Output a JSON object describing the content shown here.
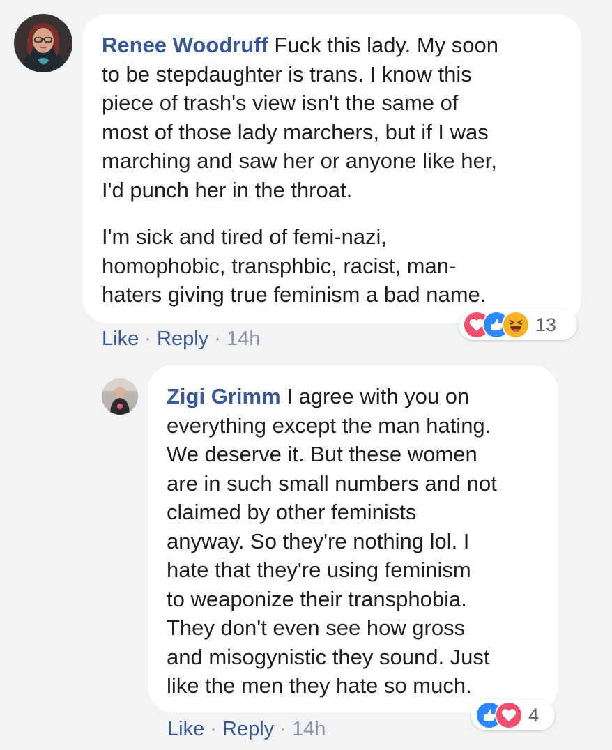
{
  "colors": {
    "background": "#f2f3f5",
    "bubble": "#ffffff",
    "author": "#385898",
    "meta": "#90949c",
    "love": "#f0506e",
    "like": "#2d88ff",
    "haha": "#f7b125"
  },
  "comments": [
    {
      "author": "Renee Woodruff",
      "paragraphs": [
        " Fuck this lady. My soon\nto be stepdaughter is trans. I know this\npiece of trash's view isn't the same of\nmost of those lady marchers, but if I was\nmarching and saw her or anyone like her,\nI'd punch her in the throat.",
        "I'm sick and tired of femi-nazi,\nhomophobic, transphbic, racist, man-\nhaters giving true feminism a bad name."
      ],
      "like_label": "Like",
      "reply_label": "Reply",
      "separator": "·",
      "time": "14h",
      "reaction_icons": [
        "love-icon",
        "like-icon",
        "haha-icon"
      ],
      "reaction_count": "13"
    },
    {
      "author": "Zigi Grimm",
      "paragraphs": [
        " I agree with you on\neverything except the man hating.\nWe deserve it. But these women\nare in such small numbers and not\nclaimed by other feminists\nanyway. So they're nothing lol. I\nhate that they're using feminism\nto weaponize their transphobia.\nThey don't even see how gross\nand misogynistic they sound. Just\nlike the men they hate so much."
      ],
      "like_label": "Like",
      "reply_label": "Reply",
      "separator": "·",
      "time": "14h",
      "reaction_icons": [
        "like-icon",
        "love-icon"
      ],
      "reaction_count": "4"
    }
  ]
}
